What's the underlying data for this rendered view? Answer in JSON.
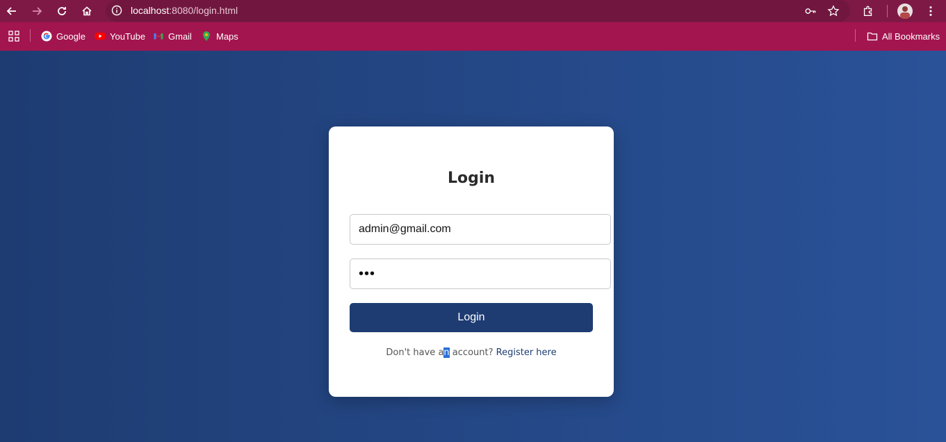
{
  "browser": {
    "url_host": "localhost",
    "url_path": ":8080/login.html",
    "bookmarks": [
      {
        "label": "Google",
        "icon": "google-icon"
      },
      {
        "label": "YouTube",
        "icon": "youtube-icon"
      },
      {
        "label": "Gmail",
        "icon": "gmail-icon"
      },
      {
        "label": "Maps",
        "icon": "maps-icon"
      }
    ],
    "all_bookmarks_label": "All Bookmarks"
  },
  "login": {
    "title": "Login",
    "email_value": "admin@gmail.com",
    "password_value": "•••",
    "button_label": "Login",
    "register_prefix_1": "Don't have a",
    "register_selected": "n",
    "register_prefix_2": " account? ",
    "register_link": "Register here"
  },
  "colors": {
    "chrome": "#a3154f",
    "toolbar": "#7e1946",
    "page_gradient_start": "#1e3c72",
    "page_gradient_end": "#2a5298",
    "button": "#1e3c72"
  }
}
